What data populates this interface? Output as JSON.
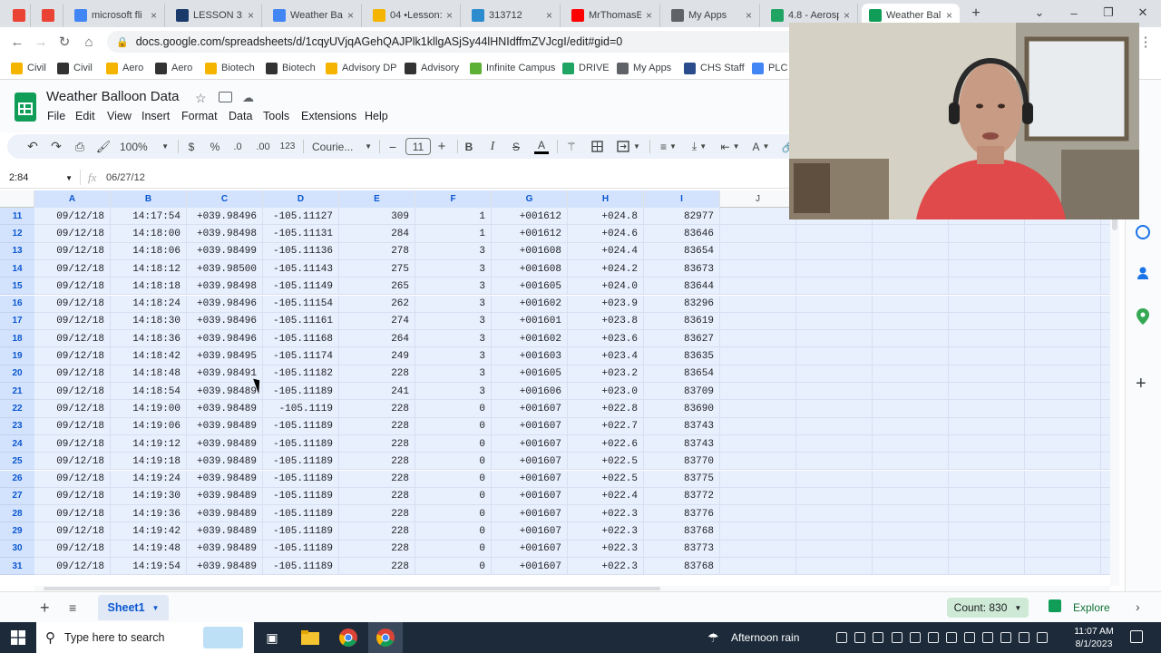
{
  "browser": {
    "tabs": [
      {
        "label": "",
        "icon": "gmail-icon"
      },
      {
        "label": "",
        "icon": "gmail-icon"
      },
      {
        "label": "microsoft fli",
        "icon": "google-icon"
      },
      {
        "label": "LESSON 3: V",
        "icon": "schoology-icon"
      },
      {
        "label": "Weather Bal",
        "icon": "docs-icon"
      },
      {
        "label": "04 •Lesson: /",
        "icon": "slides-icon"
      },
      {
        "label": "313712",
        "icon": "edpuzzle-icon"
      },
      {
        "label": "MrThomasE",
        "icon": "youtube-icon"
      },
      {
        "label": "My Apps",
        "icon": "apps-icon"
      },
      {
        "label": "4.8 - Aerosp",
        "icon": "drive-icon"
      },
      {
        "label": "Weather Bal",
        "icon": "sheets-icon"
      }
    ],
    "new_tab": "+",
    "url": "docs.google.com/spreadsheets/d/1cqyUVjqAGehQAJPlk1kllgASjSy44lHNIdffmZVJcgI/edit#gid=0",
    "bookmarks": [
      {
        "label": "Civil",
        "color": "#f4b400"
      },
      {
        "label": "Civil",
        "color": "#333333"
      },
      {
        "label": "Aero",
        "color": "#f4b400"
      },
      {
        "label": "Aero",
        "color": "#333333"
      },
      {
        "label": "Biotech",
        "color": "#f4b400"
      },
      {
        "label": "Biotech",
        "color": "#333333"
      },
      {
        "label": "Advisory DP",
        "color": "#f4b400"
      },
      {
        "label": "Advisory",
        "color": "#333333"
      },
      {
        "label": "Infinite Campus",
        "color": "#5bb035"
      },
      {
        "label": "DRIVE",
        "color": "#1fa463"
      },
      {
        "label": "My Apps",
        "color": "#5f6368"
      },
      {
        "label": "CHS Staff",
        "color": "#2b4c8c"
      },
      {
        "label": "PLC",
        "color": "#4285f4"
      }
    ]
  },
  "sheets": {
    "title": "Weather Balloon Data",
    "menus": [
      "File",
      "Edit",
      "View",
      "Insert",
      "Format",
      "Data",
      "Tools",
      "Extensions",
      "Help"
    ],
    "toolbar": {
      "zoom": "100%",
      "currency": "$",
      "percent": "%",
      "dec_decrease": ".0",
      "dec_increase": ".00",
      "number_format": "123",
      "font": "Courie...",
      "font_size": "11",
      "minus": "−",
      "plus": "+",
      "bold": "B",
      "italic": "I",
      "strike": "S",
      "textcolor": "A"
    },
    "name_box": "2:84",
    "formula": "06/27/12",
    "columns": [
      "A",
      "B",
      "C",
      "D",
      "E",
      "F",
      "G",
      "H",
      "I",
      "J",
      "",
      "",
      "",
      ""
    ],
    "rows": [
      {
        "n": "11",
        "c": [
          "09/12/18",
          "14:17:54",
          "+039.98496",
          "-105.11127",
          "309",
          "1",
          "+001612",
          "+024.8",
          "82977"
        ]
      },
      {
        "n": "12",
        "c": [
          "09/12/18",
          "14:18:00",
          "+039.98498",
          "-105.11131",
          "284",
          "1",
          "+001612",
          "+024.6",
          "83646"
        ]
      },
      {
        "n": "13",
        "c": [
          "09/12/18",
          "14:18:06",
          "+039.98499",
          "-105.11136",
          "278",
          "3",
          "+001608",
          "+024.4",
          "83654"
        ]
      },
      {
        "n": "14",
        "c": [
          "09/12/18",
          "14:18:12",
          "+039.98500",
          "-105.11143",
          "275",
          "3",
          "+001608",
          "+024.2",
          "83673"
        ]
      },
      {
        "n": "15",
        "c": [
          "09/12/18",
          "14:18:18",
          "+039.98498",
          "-105.11149",
          "265",
          "3",
          "+001605",
          "+024.0",
          "83644"
        ]
      },
      {
        "n": "16",
        "c": [
          "09/12/18",
          "14:18:24",
          "+039.98496",
          "-105.11154",
          "262",
          "3",
          "+001602",
          "+023.9",
          "83296"
        ]
      },
      {
        "n": "17",
        "c": [
          "09/12/18",
          "14:18:30",
          "+039.98496",
          "-105.11161",
          "274",
          "3",
          "+001601",
          "+023.8",
          "83619"
        ]
      },
      {
        "n": "18",
        "c": [
          "09/12/18",
          "14:18:36",
          "+039.98496",
          "-105.11168",
          "264",
          "3",
          "+001602",
          "+023.6",
          "83627"
        ]
      },
      {
        "n": "19",
        "c": [
          "09/12/18",
          "14:18:42",
          "+039.98495",
          "-105.11174",
          "249",
          "3",
          "+001603",
          "+023.4",
          "83635"
        ]
      },
      {
        "n": "20",
        "c": [
          "09/12/18",
          "14:18:48",
          "+039.98491",
          "-105.11182",
          "228",
          "3",
          "+001605",
          "+023.2",
          "83654"
        ]
      },
      {
        "n": "21",
        "c": [
          "09/12/18",
          "14:18:54",
          "+039.98489",
          "-105.11189",
          "241",
          "3",
          "+001606",
          "+023.0",
          "83709"
        ]
      },
      {
        "n": "22",
        "c": [
          "09/12/18",
          "14:19:00",
          "+039.98489",
          "-105.1119",
          "228",
          "0",
          "+001607",
          "+022.8",
          "83690"
        ]
      },
      {
        "n": "23",
        "c": [
          "09/12/18",
          "14:19:06",
          "+039.98489",
          "-105.11189",
          "228",
          "0",
          "+001607",
          "+022.7",
          "83743"
        ]
      },
      {
        "n": "24",
        "c": [
          "09/12/18",
          "14:19:12",
          "+039.98489",
          "-105.11189",
          "228",
          "0",
          "+001607",
          "+022.6",
          "83743"
        ]
      },
      {
        "n": "25",
        "c": [
          "09/12/18",
          "14:19:18",
          "+039.98489",
          "-105.11189",
          "228",
          "0",
          "+001607",
          "+022.5",
          "83770"
        ]
      },
      {
        "n": "26",
        "c": [
          "09/12/18",
          "14:19:24",
          "+039.98489",
          "-105.11189",
          "228",
          "0",
          "+001607",
          "+022.5",
          "83775"
        ]
      },
      {
        "n": "27",
        "c": [
          "09/12/18",
          "14:19:30",
          "+039.98489",
          "-105.11189",
          "228",
          "0",
          "+001607",
          "+022.4",
          "83772"
        ]
      },
      {
        "n": "28",
        "c": [
          "09/12/18",
          "14:19:36",
          "+039.98489",
          "-105.11189",
          "228",
          "0",
          "+001607",
          "+022.3",
          "83776"
        ]
      },
      {
        "n": "29",
        "c": [
          "09/12/18",
          "14:19:42",
          "+039.98489",
          "-105.11189",
          "228",
          "0",
          "+001607",
          "+022.3",
          "83768"
        ]
      },
      {
        "n": "30",
        "c": [
          "09/12/18",
          "14:19:48",
          "+039.98489",
          "-105.11189",
          "228",
          "0",
          "+001607",
          "+022.3",
          "83773"
        ]
      },
      {
        "n": "31",
        "c": [
          "09/12/18",
          "14:19:54",
          "+039.98489",
          "-105.11189",
          "228",
          "0",
          "+001607",
          "+022.3",
          "83768"
        ]
      }
    ],
    "sheet_tab": "Sheet1",
    "count": "Count: 830",
    "explore": "Explore"
  },
  "taskbar": {
    "search_placeholder": "Type here to search",
    "weather": "Afternoon rain",
    "time": "11:07 AM",
    "date": "8/1/2023"
  },
  "colors": {
    "sheets_green": "#0f9d58",
    "selection_fill": "#e8f0fe",
    "row_header_selected": "#d3e3fd",
    "accent_blue": "#0b57d0",
    "count_chip": "#ceead6"
  }
}
